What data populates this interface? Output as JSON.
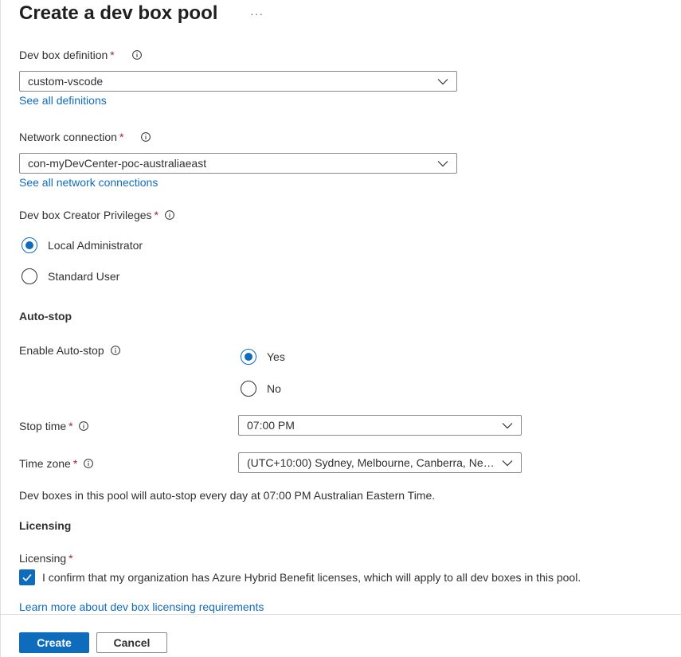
{
  "page": {
    "title": "Create a dev box pool",
    "more_menu": "···"
  },
  "definition": {
    "label": "Dev box definition",
    "required_marker": "*",
    "value": "custom-vscode",
    "link": "See all definitions"
  },
  "network": {
    "label": "Network connection",
    "required_marker": "*",
    "value": "con-myDevCenter-poc-australiaeast",
    "link": "See all network connections"
  },
  "privileges": {
    "label": "Dev box Creator Privileges",
    "required_marker": "*",
    "options": [
      {
        "label": "Local Administrator",
        "selected": true
      },
      {
        "label": "Standard User",
        "selected": false
      }
    ]
  },
  "autostop": {
    "section_title": "Auto-stop",
    "enable_label": "Enable Auto-stop",
    "enable_options": [
      {
        "label": "Yes",
        "selected": true
      },
      {
        "label": "No",
        "selected": false
      }
    ],
    "stop_time_label": "Stop time",
    "stop_time_required": "*",
    "stop_time_value": "07:00 PM",
    "time_zone_label": "Time zone",
    "time_zone_required": "*",
    "time_zone_value": "(UTC+10:00) Sydney, Melbourne, Canberra, New...",
    "summary": "Dev boxes in this pool will auto-stop every day at 07:00 PM Australian Eastern Time."
  },
  "licensing": {
    "section_title": "Licensing",
    "label": "Licensing",
    "required_marker": "*",
    "checkbox_checked": true,
    "checkbox_text": "I confirm that my organization has Azure Hybrid Benefit licenses, which will apply to all dev boxes in this pool.",
    "learn_more": "Learn more about dev box licensing requirements"
  },
  "footer": {
    "create_label": "Create",
    "cancel_label": "Cancel"
  },
  "colors": {
    "accent": "#0f6cbd",
    "required": "#a4262c",
    "text": "#323130"
  }
}
